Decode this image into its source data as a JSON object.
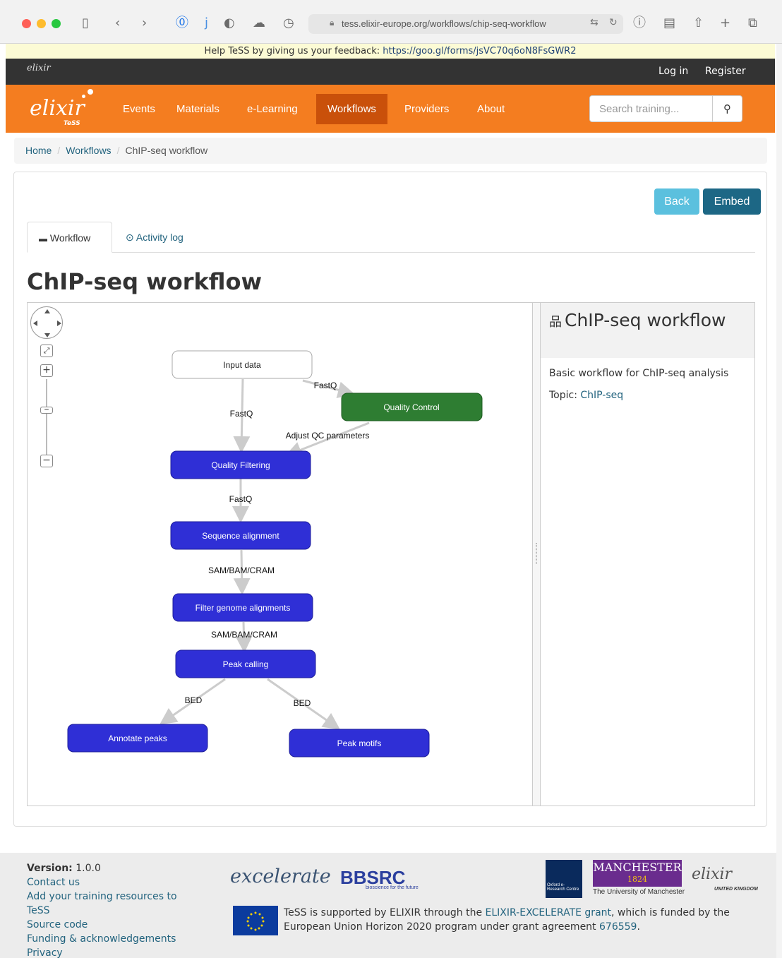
{
  "browser": {
    "url": "tess.elixir-europe.org/workflows/chip-seq-workflow"
  },
  "feedback": {
    "text": "Help TeSS by giving us your feedback: ",
    "link": "https://goo.gl/forms/jsVC70q6oN8FsGWR2"
  },
  "topbar": {
    "logo": "elixir",
    "login": "Log in",
    "register": "Register"
  },
  "nav": {
    "logo_text": "elixir",
    "logo_sub": "TeSS",
    "items": [
      "Events",
      "Materials",
      "e-Learning",
      "Workflows",
      "Providers",
      "About"
    ],
    "active": "Workflows",
    "search_placeholder": "Search training..."
  },
  "breadcrumb": {
    "home": "Home",
    "workflows": "Workflows",
    "current": "ChIP-seq workflow"
  },
  "actions": {
    "back": "Back",
    "embed": "Embed"
  },
  "tabs": {
    "workflow": "Workflow",
    "activity": "Activity log"
  },
  "page_title": "ChIP-seq workflow",
  "sidebar": {
    "title": "ChIP-seq workflow",
    "description": "Basic workflow for ChIP-seq analysis",
    "topic_label": "Topic: ",
    "topic_value": "ChIP-seq"
  },
  "workflow": {
    "colors": {
      "input": "#ffffff",
      "qc": "#2e7d32",
      "step": "#2f2fd6",
      "edge": "#cccccc"
    },
    "nodes": {
      "input": "Input data",
      "qc": "Quality Control",
      "filtering": "Quality Filtering",
      "alignment": "Sequence alignment",
      "filter_genome": "Filter genome alignments",
      "peak_calling": "Peak calling",
      "annotate": "Annotate peaks",
      "motifs": "Peak motifs"
    },
    "edges": {
      "input_qc": "FastQ",
      "input_filtering": "FastQ",
      "qc_filtering": "Adjust QC parameters",
      "filtering_alignment": "FastQ",
      "alignment_filter": "SAM/BAM/CRAM",
      "filter_peak": "SAM/BAM/CRAM",
      "peak_annotate": "BED",
      "peak_motifs": "BED"
    }
  },
  "footer": {
    "version_label": "Version:",
    "version_value": "1.0.0",
    "links": [
      "Contact us",
      "Add your training resources to TeSS",
      "Source code",
      "Funding & acknowledgements",
      "Privacy"
    ],
    "support_1": "TeSS is supported by ELIXIR through the ",
    "support_link": "ELIXIR-EXCELERATE grant",
    "support_2": ", which is funded by the European Union Horizon 2020 program under grant agreement ",
    "support_grant": "676559",
    "support_end": ".",
    "logos": {
      "excelerate": "excelerate",
      "bbsrc": "BBSRC",
      "bbsrc_sub": "bioscience for the future",
      "oxford": "Oxford e-Research Centre",
      "manchester": "MANCHESTER",
      "manchester_year": "1824",
      "manchester_sub": "The University of Manchester",
      "elixir": "elixir",
      "elixir_sub": "UNITED KINGDOM"
    }
  }
}
